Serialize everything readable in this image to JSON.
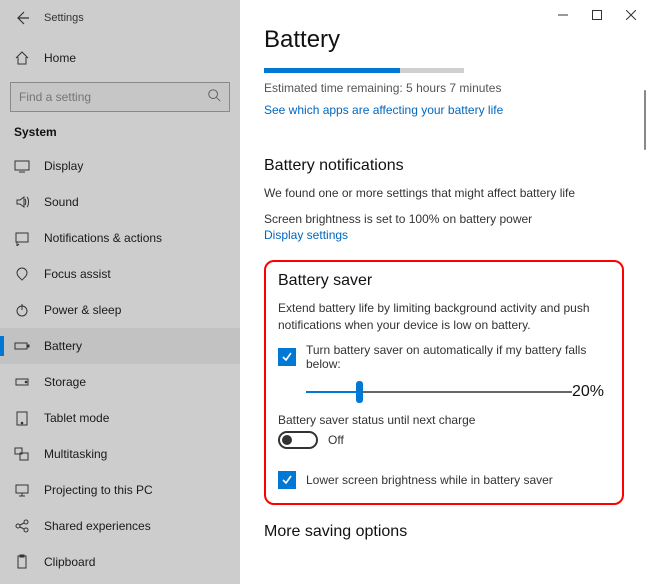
{
  "titlebar": {
    "app_name": "Settings"
  },
  "sidebar": {
    "home": "Home",
    "search_placeholder": "Find a setting",
    "group": "System",
    "items": [
      {
        "label": "Display"
      },
      {
        "label": "Sound"
      },
      {
        "label": "Notifications & actions"
      },
      {
        "label": "Focus assist"
      },
      {
        "label": "Power & sleep"
      },
      {
        "label": "Battery"
      },
      {
        "label": "Storage"
      },
      {
        "label": "Tablet mode"
      },
      {
        "label": "Multitasking"
      },
      {
        "label": "Projecting to this PC"
      },
      {
        "label": "Shared experiences"
      },
      {
        "label": "Clipboard"
      }
    ]
  },
  "page": {
    "title": "Battery",
    "progress_percent": 68,
    "estimated": "Estimated time remaining: 5 hours 7 minutes",
    "apps_link": "See which apps are affecting your battery life",
    "notif_title": "Battery notifications",
    "notif_body": "We found one or more settings that might affect battery life",
    "brightness_note": "Screen brightness is set to 100% on battery power",
    "display_settings_link": "Display settings",
    "saver": {
      "title": "Battery saver",
      "desc": "Extend battery life by limiting background activity and push notifications when your device is low on battery.",
      "auto_label": "Turn battery saver on automatically if my battery falls below:",
      "slider_value": "20%",
      "slider_percent": 20,
      "status_label": "Battery saver status until next charge",
      "status_state": "Off",
      "lower_brightness": "Lower screen brightness while in battery saver"
    },
    "more_title": "More saving options"
  }
}
